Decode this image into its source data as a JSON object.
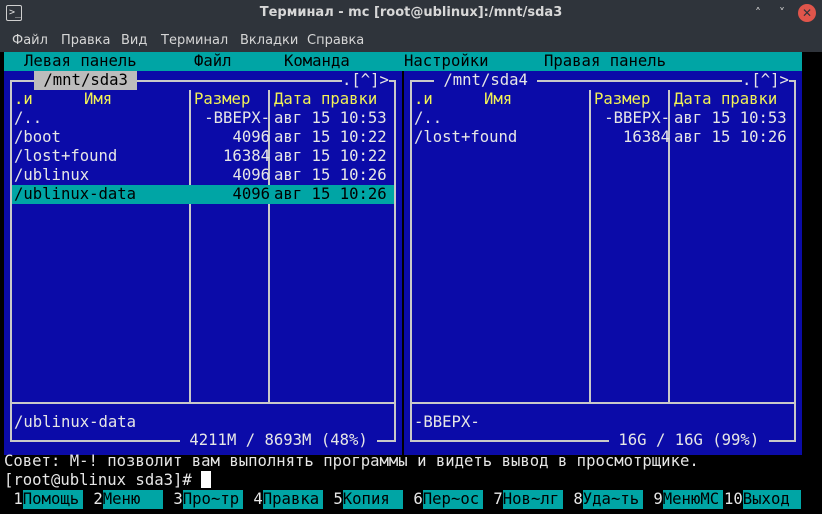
{
  "window": {
    "title": "Терминал - mc [root@ublinux]:/mnt/sda3",
    "controls": [
      "˄",
      "˅",
      "✕"
    ]
  },
  "menubar": [
    "Файл",
    "Правка",
    "Вид",
    "Терминал",
    "Вкладки",
    "Справка"
  ],
  "mc_menu": [
    "Левая панель",
    "Файл",
    "Команда",
    "Настройки",
    "Правая панель"
  ],
  "left_panel": {
    "path": " /mnt/sda3 ",
    "corner": ".[^]>",
    "headers": {
      "name_col": ".и",
      "name": "Имя",
      "size": "Размер",
      "date": "Дата правки"
    },
    "rows": [
      {
        "name": "/..",
        "size": "-ВВЕРХ-",
        "date": "авг 15 10:53"
      },
      {
        "name": "/boot",
        "size": "4096",
        "date": "авг 15 10:22"
      },
      {
        "name": "/lost+found",
        "size": "16384",
        "date": "авг 15 10:22"
      },
      {
        "name": "/ublinux",
        "size": "4096",
        "date": "авг 15 10:26"
      },
      {
        "name": "/ublinux-data",
        "size": "4096",
        "date": "авг 15 10:26"
      }
    ],
    "selected_index": 4,
    "status": "/ublinux-data",
    "disk": " 4211M / 8693M (48%) "
  },
  "right_panel": {
    "path": " /mnt/sda4 ",
    "corner": ".[^]>",
    "headers": {
      "name_col": ".и",
      "name": "Имя",
      "size": "Размер",
      "date": "Дата правки"
    },
    "rows": [
      {
        "name": "/..",
        "size": "-ВВЕРХ-",
        "date": "авг 15 10:53"
      },
      {
        "name": "/lost+found",
        "size": "16384",
        "date": "авг 15 10:26"
      }
    ],
    "status": "-ВВЕРХ-",
    "disk": " 16G / 16G (99%) "
  },
  "tip": "Совет: M-! позволит вам выполнять программы и видеть вывод в просмотрщике.",
  "prompt": "[root@ublinux sda3]# ",
  "fkeys": [
    {
      "num": " 1",
      "label": "Помощь"
    },
    {
      "num": " 2",
      "label": "Меню"
    },
    {
      "num": " 3",
      "label": "Про~тр"
    },
    {
      "num": " 4",
      "label": "Правка"
    },
    {
      "num": " 5",
      "label": "Копия"
    },
    {
      "num": " 6",
      "label": "Пер~ос"
    },
    {
      "num": " 7",
      "label": "Нов~лг"
    },
    {
      "num": " 8",
      "label": "Уда~ть"
    },
    {
      "num": " 9",
      "label": "МенюMC"
    },
    {
      "num": "10",
      "label": "Выход"
    }
  ],
  "colors": {
    "panel_bg": "#0b0ba8",
    "accent": "#00a5a5",
    "header_text": "#f2f255"
  }
}
